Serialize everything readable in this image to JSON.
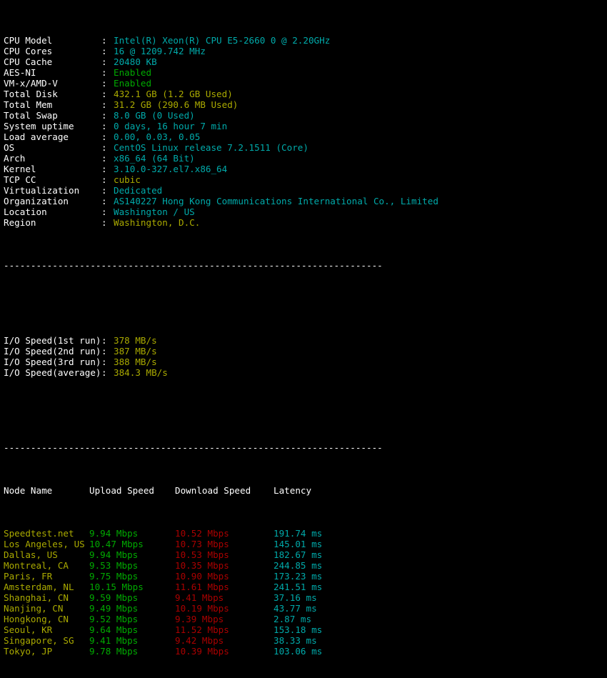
{
  "terminal": {
    "separator": "----------------------------------------------------------------------",
    "sysinfo": [
      {
        "label": "CPU Model",
        "value": "Intel(R) Xeon(R) CPU E5-2660 0 @ 2.20GHz",
        "color": "cyan"
      },
      {
        "label": "CPU Cores",
        "value": "16 @ 1209.742 MHz",
        "color": "cyan"
      },
      {
        "label": "CPU Cache",
        "value": "20480 KB",
        "color": "cyan"
      },
      {
        "label": "AES-NI",
        "value": "Enabled",
        "color": "green"
      },
      {
        "label": "VM-x/AMD-V",
        "value": "Enabled",
        "color": "green"
      },
      {
        "label": "Total Disk",
        "value": "432.1 GB (1.2 GB Used)",
        "color": "yellow"
      },
      {
        "label": "Total Mem",
        "value": "31.2 GB (290.6 MB Used)",
        "color": "yellow"
      },
      {
        "label": "Total Swap",
        "value": "8.0 GB (0 Used)",
        "color": "cyan"
      },
      {
        "label": "System uptime",
        "value": "0 days, 16 hour 7 min",
        "color": "cyan"
      },
      {
        "label": "Load average",
        "value": "0.00, 0.03, 0.05",
        "color": "cyan"
      },
      {
        "label": "OS",
        "value": "CentOS Linux release 7.2.1511 (Core)",
        "color": "cyan"
      },
      {
        "label": "Arch",
        "value": "x86_64 (64 Bit)",
        "color": "cyan"
      },
      {
        "label": "Kernel",
        "value": "3.10.0-327.el7.x86_64",
        "color": "cyan"
      },
      {
        "label": "TCP CC",
        "value": "cubic",
        "color": "yellow"
      },
      {
        "label": "Virtualization",
        "value": "Dedicated",
        "color": "cyan"
      },
      {
        "label": "Organization",
        "value": "AS140227 Hong Kong Communications International Co., Limited",
        "color": "cyan"
      },
      {
        "label": "Location",
        "value": "Washington / US",
        "color": "cyan"
      },
      {
        "label": "Region",
        "value": "Washington, D.C.",
        "color": "yellow"
      }
    ],
    "io": [
      {
        "label": "I/O Speed(1st run)",
        "value": "378 MB/s",
        "color": "yellow"
      },
      {
        "label": "I/O Speed(2nd run)",
        "value": "387 MB/s",
        "color": "yellow"
      },
      {
        "label": "I/O Speed(3rd run)",
        "value": "388 MB/s",
        "color": "yellow"
      },
      {
        "label": "I/O Speed(average)",
        "value": "384.3 MB/s",
        "color": "yellow"
      }
    ],
    "speedtest": {
      "headers": {
        "node": "Node Name",
        "upload": "Upload Speed",
        "download": "Download Speed",
        "latency": "Latency"
      },
      "rows": [
        {
          "node": "Speedtest.net",
          "upload": "9.94 Mbps",
          "download": "10.52 Mbps",
          "latency": "191.74 ms"
        },
        {
          "node": "Los Angeles, US",
          "upload": "10.47 Mbps",
          "download": "10.73 Mbps",
          "latency": "145.01 ms"
        },
        {
          "node": "Dallas, US",
          "upload": "9.94 Mbps",
          "download": "10.53 Mbps",
          "latency": "182.67 ms"
        },
        {
          "node": "Montreal, CA",
          "upload": "9.53 Mbps",
          "download": "10.35 Mbps",
          "latency": "244.85 ms"
        },
        {
          "node": "Paris, FR",
          "upload": "9.75 Mbps",
          "download": "10.90 Mbps",
          "latency": "173.23 ms"
        },
        {
          "node": "Amsterdam, NL",
          "upload": "10.15 Mbps",
          "download": "11.61 Mbps",
          "latency": "241.51 ms"
        },
        {
          "node": "Shanghai, CN",
          "upload": "9.59 Mbps",
          "download": "9.41 Mbps",
          "latency": "37.16 ms"
        },
        {
          "node": "Nanjing, CN",
          "upload": "9.49 Mbps",
          "download": "10.19 Mbps",
          "latency": "43.77 ms"
        },
        {
          "node": "Hongkong, CN",
          "upload": "9.52 Mbps",
          "download": "9.39 Mbps",
          "latency": "2.87 ms"
        },
        {
          "node": "Seoul, KR",
          "upload": "9.64 Mbps",
          "download": "11.52 Mbps",
          "latency": "153.18 ms"
        },
        {
          "node": "Singapore, SG",
          "upload": "9.41 Mbps",
          "download": "9.42 Mbps",
          "latency": "38.33 ms"
        },
        {
          "node": "Tokyo, JP",
          "upload": "9.78 Mbps",
          "download": "10.39 Mbps",
          "latency": "103.06 ms"
        }
      ]
    },
    "colors": {
      "background": "#000000",
      "foreground": "#ffffff",
      "cyan": "#00aaaa",
      "green": "#00aa00",
      "yellow": "#aaaa00",
      "red": "#aa0000"
    }
  }
}
